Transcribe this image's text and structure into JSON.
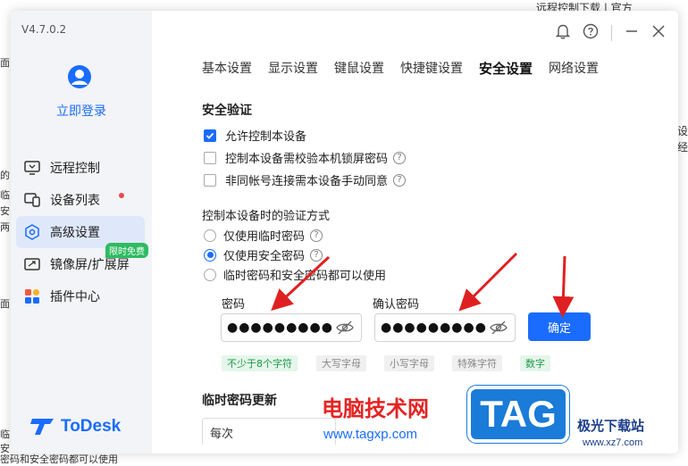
{
  "background": {
    "top_text": "远程控制下载 | 官方",
    "left_fragments": [
      "面",
      "的",
      "临",
      "安",
      "两",
      "面",
      "临",
      "安"
    ],
    "right_fragments": [
      "设",
      "经"
    ],
    "bottom_text": "密码和安全密码都可以使用"
  },
  "app": {
    "version": "V4.7.0.2",
    "login_label": "立即登录",
    "brand_name": "ToDesk",
    "brand_color": "#1a6cff"
  },
  "sidebar": {
    "items": [
      {
        "label": "远程控制",
        "icon": "monitor-icon"
      },
      {
        "label": "设备列表",
        "icon": "devices-icon",
        "dot": true
      },
      {
        "label": "高级设置",
        "icon": "settings-hex-icon",
        "active": true
      },
      {
        "label": "镜像屏/扩展屏",
        "icon": "mirror-screen-icon",
        "badge": "限时免费"
      },
      {
        "label": "插件中心",
        "icon": "plugins-icon"
      }
    ]
  },
  "tabs": [
    "基本设置",
    "显示设置",
    "键鼠设置",
    "快捷键设置",
    "安全设置",
    "网络设置"
  ],
  "active_tab": "安全设置",
  "security": {
    "title": "安全验证",
    "options": [
      {
        "label": "允许控制本设备",
        "checked": true,
        "help": false
      },
      {
        "label": "控制本设备需校验本机锁屏密码",
        "checked": false,
        "help": true
      },
      {
        "label": "非同帐号连接需本设备手动同意",
        "checked": false,
        "help": true
      }
    ]
  },
  "verify": {
    "title": "控制本设备时的验证方式",
    "options": [
      {
        "label": "仅使用临时密码",
        "selected": false,
        "help": true
      },
      {
        "label": "仅使用安全密码",
        "selected": true,
        "help": true
      },
      {
        "label": "临时密码和安全密码都可以使用",
        "selected": false,
        "help": false
      }
    ]
  },
  "password": {
    "label": "密码",
    "value": "●●●●●●●●●",
    "confirm_label": "确认密码",
    "confirm_value": "●●●●●●●●●",
    "ok_button": "确定"
  },
  "rules": [
    {
      "label": "不少于8个字符",
      "ok": true
    },
    {
      "label": "大写字母",
      "ok": false
    },
    {
      "label": "小写字母",
      "ok": false
    },
    {
      "label": "特殊字符",
      "ok": false
    },
    {
      "label": "数字",
      "ok": true
    }
  ],
  "temp_password": {
    "title": "临时密码更新",
    "select_value": "每次"
  },
  "watermark": {
    "site_cn": "电脑技术网",
    "site_url": "www.tagxp.com",
    "tag": "TAG",
    "site2_cn": "极光下载站",
    "site2_url": "www.xz7.com"
  },
  "accent_color": "#1a6cff",
  "arrow_color": "#e02020"
}
